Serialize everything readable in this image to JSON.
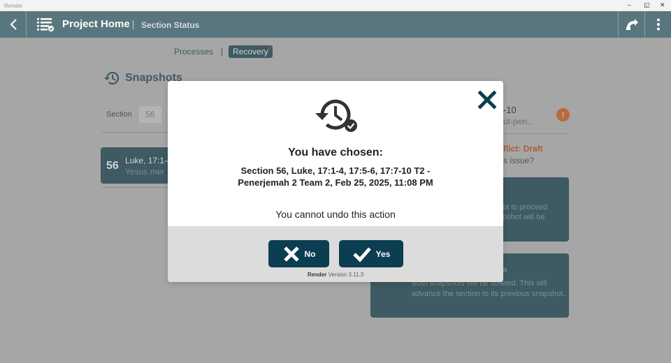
{
  "window": {
    "title": "Render",
    "min": "–",
    "restore": "◱",
    "close": "✕"
  },
  "appbar": {
    "title": "Project Home",
    "subtitle": "Section Status"
  },
  "tabs": {
    "processes": "Processes",
    "recovery": "Recovery"
  },
  "background": {
    "snapshots_title": "Snapshots",
    "section_label": "Section",
    "section_value": "56",
    "left_card": {
      "number": "56",
      "reference": "Luke, 17:1-4",
      "subtitle": "Yesus mer"
    },
    "right_reference": "-10",
    "right_subtitle": "ut-pen...",
    "warning_glyph": "!",
    "conflict_text": "flict: Draft",
    "issue_text": "s issue?",
    "option1_text": [
      "ot to proceed",
      "pshot will be"
    ],
    "option2_heading": "s",
    "option2_text": "Both snapshots will be deleted. This will advance the section to its previous snapshot."
  },
  "modal": {
    "heading": "You have chosen:",
    "detail": "Section 56, Luke, 17:1-4, 17:5-6, 17:7-10 T2 - Penerjemah 2 Team 2, Feb 25, 2025, 11:08 PM",
    "warning": "You cannot undo this action",
    "no_label": "No",
    "yes_label": "Yes",
    "app_name": "Render",
    "version": "Version 3.11.3"
  },
  "colors": {
    "appbar": "#59767e",
    "dark_teal": "#3e5a62",
    "button": "#0a3e50",
    "overlay": "#a6a6a6",
    "conflict": "#a95e34"
  }
}
